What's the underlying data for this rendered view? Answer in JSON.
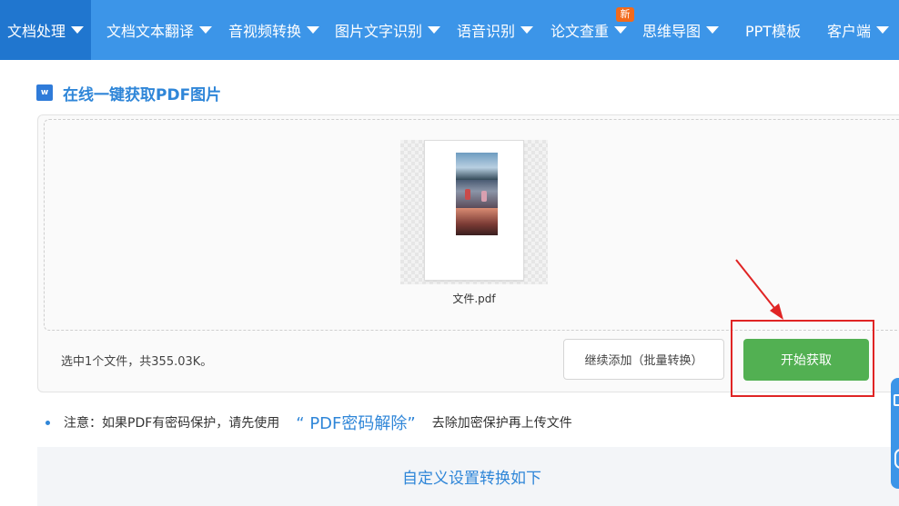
{
  "nav": {
    "items": [
      {
        "label": "文档处理",
        "active": true
      },
      {
        "label": "文档文本翻译"
      },
      {
        "label": "音视频转换"
      },
      {
        "label": "图片文字识别"
      },
      {
        "label": "语音识别"
      },
      {
        "label": "论文查重"
      },
      {
        "label": "思维导图"
      },
      {
        "label": "PPT模板"
      },
      {
        "label": "客户端"
      }
    ],
    "new_badge": "新"
  },
  "page": {
    "icon_letter": "w",
    "title": "在线一键获取PDF图片"
  },
  "upload": {
    "file_name": "文件.pdf",
    "status_text": "选中1个文件，共355.03K。",
    "add_button": "继续添加（批量转换）",
    "start_button": "开始获取"
  },
  "note": {
    "prefix": "注意：如果PDF有密码保护，请先使用",
    "link": "“ PDF密码解除”",
    "suffix": "去除加密保护再上传文件"
  },
  "settings": {
    "label": "自定义设置转换如下"
  },
  "colors": {
    "nav_bg": "#3c95e8",
    "nav_active": "#2076cf",
    "accent": "#2f86d8",
    "start_green": "#52b052",
    "highlight_red": "#e02424",
    "badge_orange": "#f26a1b"
  }
}
